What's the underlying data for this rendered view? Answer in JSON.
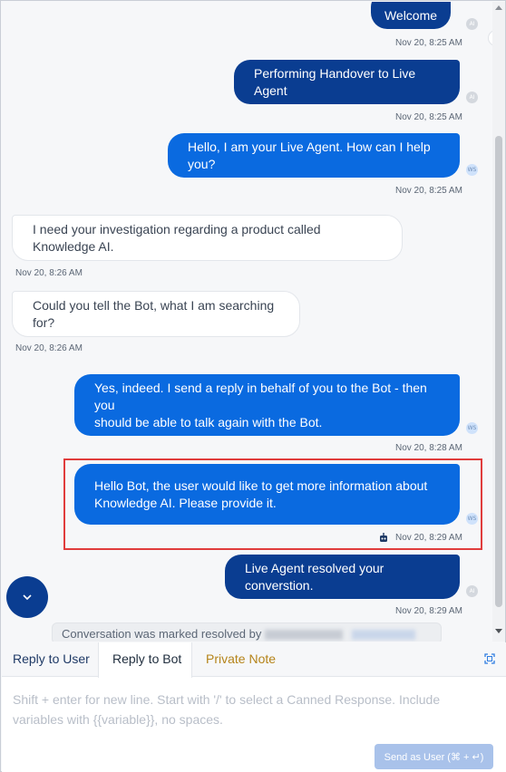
{
  "messages": [
    {
      "text": "Welcome",
      "time": "Nov 20, 8:25 AM",
      "avatar": "AI"
    },
    {
      "text": "Performing Handover to Live Agent",
      "time": "Nov 20, 8:25 AM",
      "avatar": "AI"
    },
    {
      "text": "Hello, I am your Live Agent. How can I help you?",
      "time": "Nov 20, 8:25 AM",
      "avatar": "WS"
    },
    {
      "text": "I need your investigation regarding a product called Knowledge AI.",
      "time": "Nov 20, 8:26 AM"
    },
    {
      "text": "Could you tell the Bot, what I am searching for?",
      "time": "Nov 20, 8:26 AM"
    },
    {
      "line1": "Yes, indeed. I send a reply in behalf of you to the Bot - then you",
      "line2": "should be able to talk again with the Bot.",
      "time": "Nov 20, 8:28 AM",
      "avatar": "WS"
    },
    {
      "line1": "Hello Bot, the user would like to get more information about",
      "line2": "Knowledge AI. Please provide it.",
      "time": "Nov 20, 8:29 AM",
      "avatar": "WS"
    },
    {
      "text": "Live Agent resolved your converstion.",
      "time": "Nov 20, 8:29 AM",
      "avatar": "AI"
    }
  ],
  "resolved_text": "Conversation was marked resolved by",
  "tabs": [
    "Reply to User",
    "Reply to Bot",
    "Private Note"
  ],
  "composer_placeholder_line1": "Shift + enter for new line. Start with '/' to select a Canned Response. Include",
  "composer_placeholder_line2": "variables with {{variable}}, no spaces.",
  "send_button": "Send as User (⌘ + ↵)",
  "colors": {
    "navy": "#0a3d91",
    "blue": "#0a6ae0",
    "highlight": "#e03c3c",
    "private_note": "#b5841a"
  },
  "icons": [
    "chevron-down-icon",
    "bot-icon",
    "expand-icon",
    "chevron-right-icon"
  ]
}
